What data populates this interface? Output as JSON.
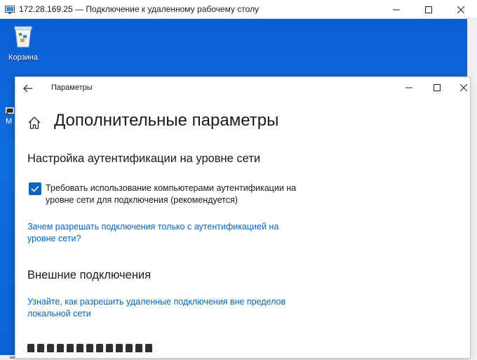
{
  "rdp_window": {
    "title": "172.28.169.25 — Подключение к удаленному рабочему столу"
  },
  "desktop": {
    "recycle_bin_label": "Корзина",
    "second_icon_label": "M"
  },
  "settings_window": {
    "title": "Параметры",
    "page_title": "Дополнительные параметры",
    "nla_section": {
      "heading": "Настройка аутентификации на уровне сети",
      "checkbox_label": "Требовать использование компьютерами аутентификации на уровне сети для подключения (рекомендуется)",
      "checkbox_checked": true,
      "help_link": "Зачем разрешать подключения только с аутентификацией на уровне сети?"
    },
    "external_section": {
      "heading": "Внешние подключения",
      "help_link": "Узнайте, как разрешить удаленные подключения вне пределов локальной сети"
    }
  },
  "colors": {
    "accent": "#0067c0",
    "desktop_blue": "#0a63d6"
  }
}
